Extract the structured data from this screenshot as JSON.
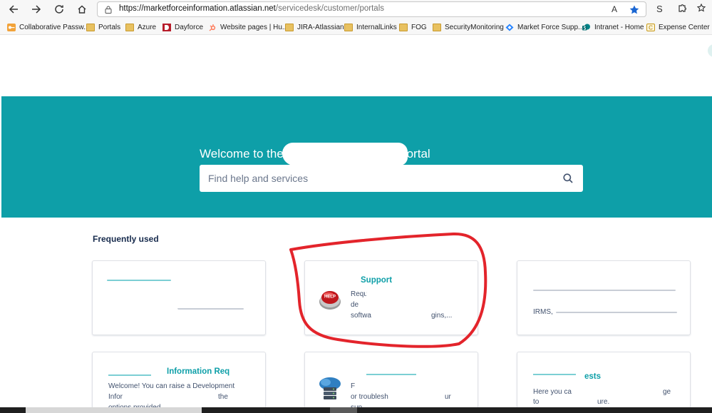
{
  "browser": {
    "url_host": "https://marketforceinformation.atlassian.net",
    "url_path": "/servicedesk/customer/portals",
    "read_aloud_icon": "A",
    "profile_letter": "S",
    "bookmarks": [
      {
        "label": "Collaborative Passw...",
        "icon": "key-icon"
      },
      {
        "label": "Portals",
        "icon": "folder-icon"
      },
      {
        "label": "Azure",
        "icon": "folder-icon"
      },
      {
        "label": "Dayforce",
        "icon": "dayforce-icon"
      },
      {
        "label": "Website pages | Hu...",
        "icon": "hubspot-icon"
      },
      {
        "label": "JIRA-Atlassian",
        "icon": "folder-icon"
      },
      {
        "label": "InternalLinks",
        "icon": "folder-icon"
      },
      {
        "label": "FOG",
        "icon": "folder-icon"
      },
      {
        "label": "SecurityMonitoring",
        "icon": "folder-icon"
      },
      {
        "label": "Market Force Supp...",
        "icon": "jira-icon"
      },
      {
        "label": "Intranet - Home",
        "icon": "sharepoint-icon"
      },
      {
        "label": "Expense Center",
        "icon": "expense-icon"
      }
    ]
  },
  "portal": {
    "welcome_prefix": "Welcome to the",
    "welcome_suffix": "Portal",
    "search_placeholder": "Find help and services",
    "frequently_used": "Frequently used"
  },
  "cards": [
    {
      "title": "",
      "desc": ""
    },
    {
      "title": "Support",
      "desc_line1": "Requ",
      "desc_line2": "de",
      "desc_line3": "softwa",
      "desc_tail": "gins,..."
    },
    {
      "title": "",
      "desc": "IRMS,"
    },
    {
      "title": "Information Req",
      "desc_line1": "Welcome! You can raise a Development",
      "desc_line2": "Infor",
      "desc_tail2": "the",
      "desc_line3": "options provided"
    },
    {
      "title": "",
      "desc_line1": "F",
      "desc_line2": "or troublesh",
      "desc_tail2": "ur",
      "desc_line3": "sup"
    },
    {
      "title": "ests",
      "desc_line1": "Here you ca",
      "desc_tail1": "ge",
      "desc_line2": "to",
      "desc_tail2": "ure."
    }
  ],
  "colors": {
    "hero": "#0e9fa8",
    "card_title": "#0e9fa8",
    "annotation": "#e3242b"
  }
}
